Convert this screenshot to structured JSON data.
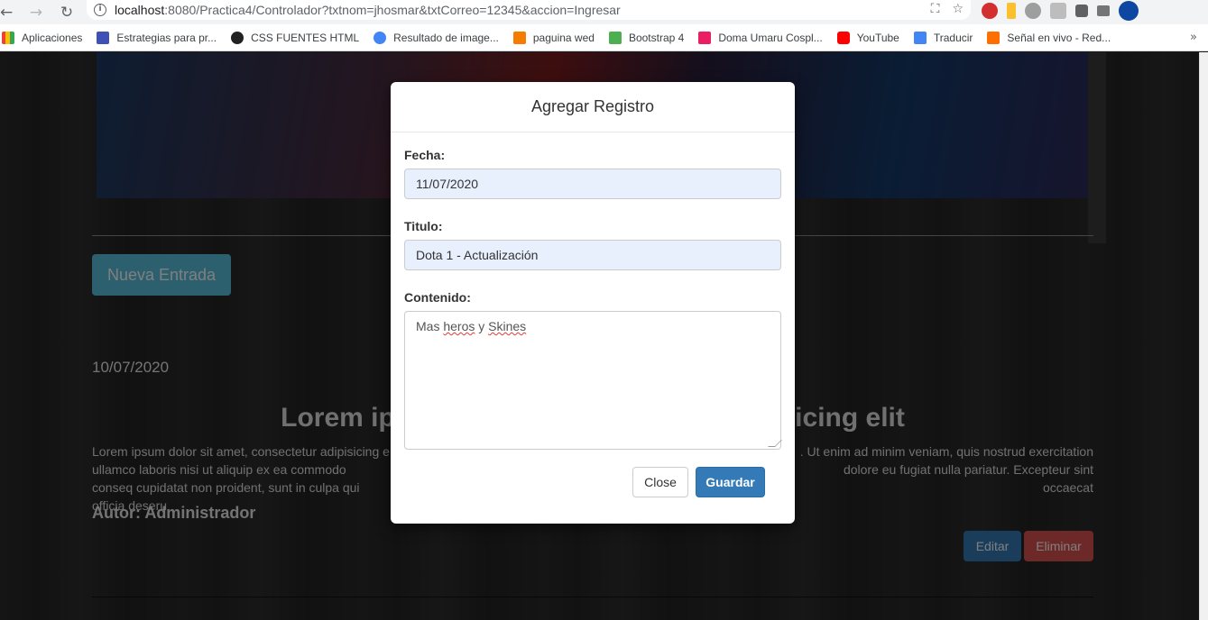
{
  "browser": {
    "url_host": "localhost",
    "url_rest": ":8080/Practica4/Controlador?txtnom=jhosmar&txtCorreo=12345&accion=Ingresar",
    "icons": [
      "back-arrow-icon",
      "forward-arrow-icon",
      "reload-icon",
      "info-icon",
      "translate-icon",
      "star-icon"
    ]
  },
  "bookmarks": [
    {
      "label": "Aplicaciones",
      "icon": "apps-grid-icon",
      "color": "#ea4335"
    },
    {
      "label": "Estrategias para pr...",
      "icon": "bookmark-site-icon",
      "color": "#3f51b5"
    },
    {
      "label": "CSS FUENTES HTML",
      "icon": "bookmark-site-icon",
      "color": "#222222"
    },
    {
      "label": "Resultado de image...",
      "icon": "google-icon",
      "color": "#4285f4"
    },
    {
      "label": "paguina wed",
      "icon": "bookmark-site-icon",
      "color": "#f57c00"
    },
    {
      "label": "Bootstrap 4",
      "icon": "bookmark-site-icon",
      "color": "#4caf50"
    },
    {
      "label": "Doma Umaru Cospl...",
      "icon": "bookmark-site-icon",
      "color": "#e91e63"
    },
    {
      "label": "YouTube",
      "icon": "youtube-icon",
      "color": "#ff0000"
    },
    {
      "label": "Traducir",
      "icon": "translate-icon",
      "color": "#4285f4"
    },
    {
      "label": "Señal en vivo - Red...",
      "icon": "bookmark-site-icon",
      "color": "#ff6f00"
    }
  ],
  "page": {
    "new_entry_label": "Nueva Entrada",
    "entry": {
      "date": "10/07/2020",
      "title_left": "Lorem ipsum",
      "title_right": "ipisicing elit",
      "body_left": "Lorem ipsum dolor sit amet, consectetur adipisicing e ullamco laboris nisi ut aliquip ex ea commodo conseq cupidatat non proident, sunt in culpa qui officia deseru",
      "body_right": ". Ut enim ad minim veniam, quis nostrud exercitation dolore eu fugiat nulla pariatur. Excepteur sint occaecat",
      "author": "Autor: Administrador",
      "edit_label": "Editar",
      "delete_label": "Eliminar"
    }
  },
  "modal": {
    "title": "Agregar Registro",
    "fecha_label": "Fecha:",
    "fecha_value": "11/07/2020",
    "titulo_label": "Titulo:",
    "titulo_value": "Dota 1 - Actualización",
    "contenido_label": "Contenido:",
    "contenido_pre": "Mas ",
    "contenido_word1": "heros",
    "contenido_mid": " y ",
    "contenido_word2": "Skines",
    "close_label": "Close",
    "save_label": "Guardar"
  }
}
